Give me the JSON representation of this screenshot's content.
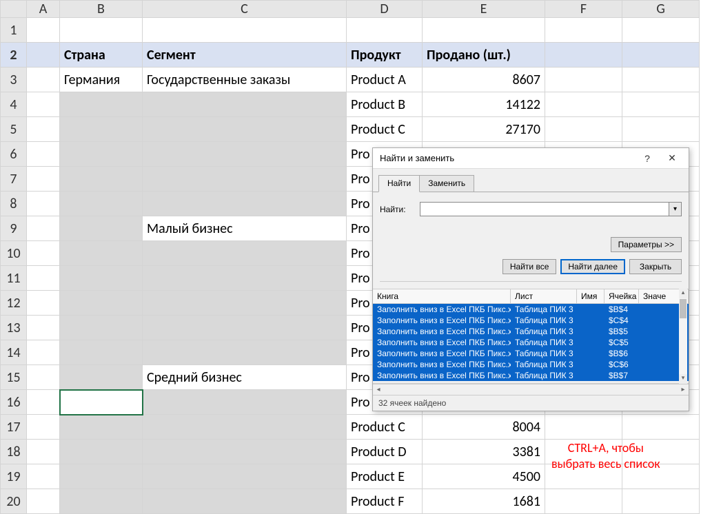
{
  "columns": [
    "A",
    "B",
    "C",
    "D",
    "E",
    "F",
    "G"
  ],
  "row_numbers": [
    1,
    2,
    3,
    4,
    5,
    6,
    7,
    8,
    9,
    10,
    11,
    12,
    13,
    14,
    15,
    16,
    17,
    18,
    19,
    20
  ],
  "headers": {
    "B": "Страна",
    "C": "Сегмент",
    "D": "Продукт",
    "E": "Продано (шт.)"
  },
  "rows": [
    {
      "n": 3,
      "B": "Германия",
      "C": "Государственные заказы",
      "D": "Product A",
      "E": "8607",
      "grayB": false,
      "grayC": false
    },
    {
      "n": 4,
      "B": "",
      "C": "",
      "D": "Product B",
      "E": "14122",
      "grayB": true,
      "grayC": true
    },
    {
      "n": 5,
      "B": "",
      "C": "",
      "D": "Product C",
      "E": "27170",
      "grayB": true,
      "grayC": true
    },
    {
      "n": 6,
      "B": "",
      "C": "",
      "D": "Pro",
      "E": "",
      "grayB": true,
      "grayC": true
    },
    {
      "n": 7,
      "B": "",
      "C": "",
      "D": "Pro",
      "E": "",
      "grayB": true,
      "grayC": true
    },
    {
      "n": 8,
      "B": "",
      "C": "",
      "D": "Pro",
      "E": "",
      "grayB": true,
      "grayC": true
    },
    {
      "n": 9,
      "B": "",
      "C": "Малый бизнес",
      "D": "Pro",
      "E": "",
      "grayB": true,
      "grayC": false
    },
    {
      "n": 10,
      "B": "",
      "C": "",
      "D": "Pro",
      "E": "",
      "grayB": true,
      "grayC": true
    },
    {
      "n": 11,
      "B": "",
      "C": "",
      "D": "Pro",
      "E": "",
      "grayB": true,
      "grayC": true
    },
    {
      "n": 12,
      "B": "",
      "C": "",
      "D": "Pro",
      "E": "",
      "grayB": true,
      "grayC": true
    },
    {
      "n": 13,
      "B": "",
      "C": "",
      "D": "Pro",
      "E": "",
      "grayB": true,
      "grayC": true
    },
    {
      "n": 14,
      "B": "",
      "C": "",
      "D": "Pro",
      "E": "",
      "grayB": true,
      "grayC": true
    },
    {
      "n": 15,
      "B": "",
      "C": "Средний бизнес",
      "D": "Pro",
      "E": "",
      "grayB": true,
      "grayC": false
    },
    {
      "n": 16,
      "B": "",
      "C": "",
      "D": "Pro",
      "E": "",
      "grayB": true,
      "grayC": true,
      "activeB": true
    },
    {
      "n": 17,
      "B": "",
      "C": "",
      "D": "Product C",
      "E": "8004",
      "grayB": true,
      "grayC": true
    },
    {
      "n": 18,
      "B": "",
      "C": "",
      "D": "Product D",
      "E": "3381",
      "grayB": true,
      "grayC": true
    },
    {
      "n": 19,
      "B": "",
      "C": "",
      "D": "Product E",
      "E": "4500",
      "grayB": true,
      "grayC": true
    },
    {
      "n": 20,
      "B": "",
      "C": "",
      "D": "Product F",
      "E": "1681",
      "grayB": true,
      "grayC": true
    }
  ],
  "annotation": "CTRL+A, чтобы\nвыбрать весь список",
  "dialog": {
    "title": "Найти и заменить",
    "tabs": {
      "find": "Найти",
      "replace": "Заменить"
    },
    "find_label": "Найти:",
    "find_value": "",
    "params_btn": "Параметры >>",
    "find_all": "Найти все",
    "find_next": "Найти далее",
    "close": "Закрыть",
    "cols": {
      "book": "Книга",
      "sheet": "Лист",
      "name": "Имя",
      "cell": "Ячейка",
      "value": "Значе"
    },
    "book_name": "Заполнить вниз в Excel ПКБ Пикс.xlsx",
    "sheet_name": "Таблица ПИК 3",
    "results": [
      "$B$4",
      "$C$4",
      "$B$5",
      "$C$5",
      "$B$6",
      "$C$6",
      "$B$7"
    ],
    "status": "32 ячеек найдено",
    "help_icon": "?",
    "close_icon": "✕"
  }
}
